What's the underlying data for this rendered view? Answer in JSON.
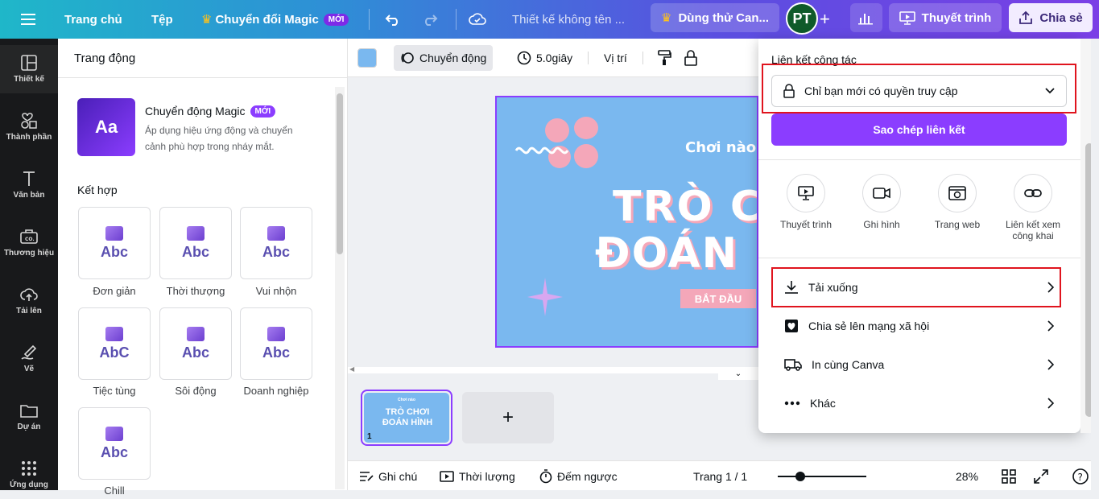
{
  "topbar": {
    "home": "Trang chủ",
    "file": "Tệp",
    "magic": "Chuyển đổi Magic",
    "magic_badge": "MỚI",
    "doc_title": "Thiết kế không tên ...",
    "try_canva": "Dùng thử Can...",
    "avatar": "PT",
    "present": "Thuyết trình",
    "share": "Chia sẻ"
  },
  "rail": [
    {
      "label": "Thiết kế",
      "icon": "layout-icon"
    },
    {
      "label": "Thành phần",
      "icon": "elements-icon"
    },
    {
      "label": "Văn bản",
      "icon": "text-icon"
    },
    {
      "label": "Thương hiệu",
      "icon": "brand-icon"
    },
    {
      "label": "Tải lên",
      "icon": "upload-cloud-icon"
    },
    {
      "label": "Vẽ",
      "icon": "draw-icon"
    },
    {
      "label": "Dự án",
      "icon": "folder-icon"
    },
    {
      "label": "Ứng dụng",
      "icon": "apps-icon"
    }
  ],
  "panel": {
    "title": "Trang động",
    "magic_title": "Chuyển động Magic",
    "magic_badge": "MỚI",
    "magic_desc_1": "Áp dụng hiệu ứng động và chuyển",
    "magic_desc_2": "cảnh phù hợp trong nháy mắt.",
    "section": "Kết hợp",
    "tiles": [
      {
        "label": "Đơn giản",
        "sample": "Abc"
      },
      {
        "label": "Thời thượng",
        "sample": "Abc"
      },
      {
        "label": "Vui nhộn",
        "sample": "Abc"
      },
      {
        "label": "Tiệc tùng",
        "sample": "AbC"
      },
      {
        "label": "Sôi động",
        "sample": "Abc"
      },
      {
        "label": "Doanh nghiệp",
        "sample": "Abc"
      },
      {
        "label": "Chill",
        "sample": "Abc"
      }
    ]
  },
  "toolbar": {
    "color": "#7ab8ef",
    "animate": "Chuyển động",
    "duration": "5.0giây",
    "position": "Vị trí"
  },
  "slide": {
    "subtitle": "Chơi nào",
    "title_1": "TRÒ CH",
    "title_2": "ĐOÁN H",
    "button": "BẮT ĐẦU"
  },
  "thumb": {
    "subtitle": "Chơi nào",
    "title_1": "TRÒ CHƠI",
    "title_2": "ĐOÁN HÌNH",
    "page_number": "1"
  },
  "bottom": {
    "notes": "Ghi chú",
    "duration": "Thời lượng",
    "timer": "Đếm ngược",
    "page": "Trang 1 / 1",
    "zoom": "28%",
    "zoom_level": 0.25
  },
  "share": {
    "collab_label": "Liên kết cộng tác",
    "access": "Chỉ bạn mới có quyền truy cập",
    "copy": "Sao chép liên kết",
    "options": [
      {
        "label": "Thuyết trình",
        "icon": "present-icon"
      },
      {
        "label": "Ghi hình",
        "icon": "record-icon"
      },
      {
        "label": "Trang web",
        "icon": "website-icon"
      },
      {
        "label": "Liên kết xem công khai",
        "icon": "link-icon"
      }
    ],
    "rows": [
      {
        "label": "Tải xuống",
        "icon": "download-icon"
      },
      {
        "label": "Chia sẻ lên mạng xã hội",
        "icon": "heart-icon"
      },
      {
        "label": "In cùng Canva",
        "icon": "truck-icon"
      },
      {
        "label": "Khác",
        "icon": "more-icon"
      }
    ]
  },
  "colors": {
    "accent": "#8b3dff",
    "highlight": "#e0141e",
    "slide_bg": "#7ab8ef",
    "pink": "#f4a7b9"
  }
}
